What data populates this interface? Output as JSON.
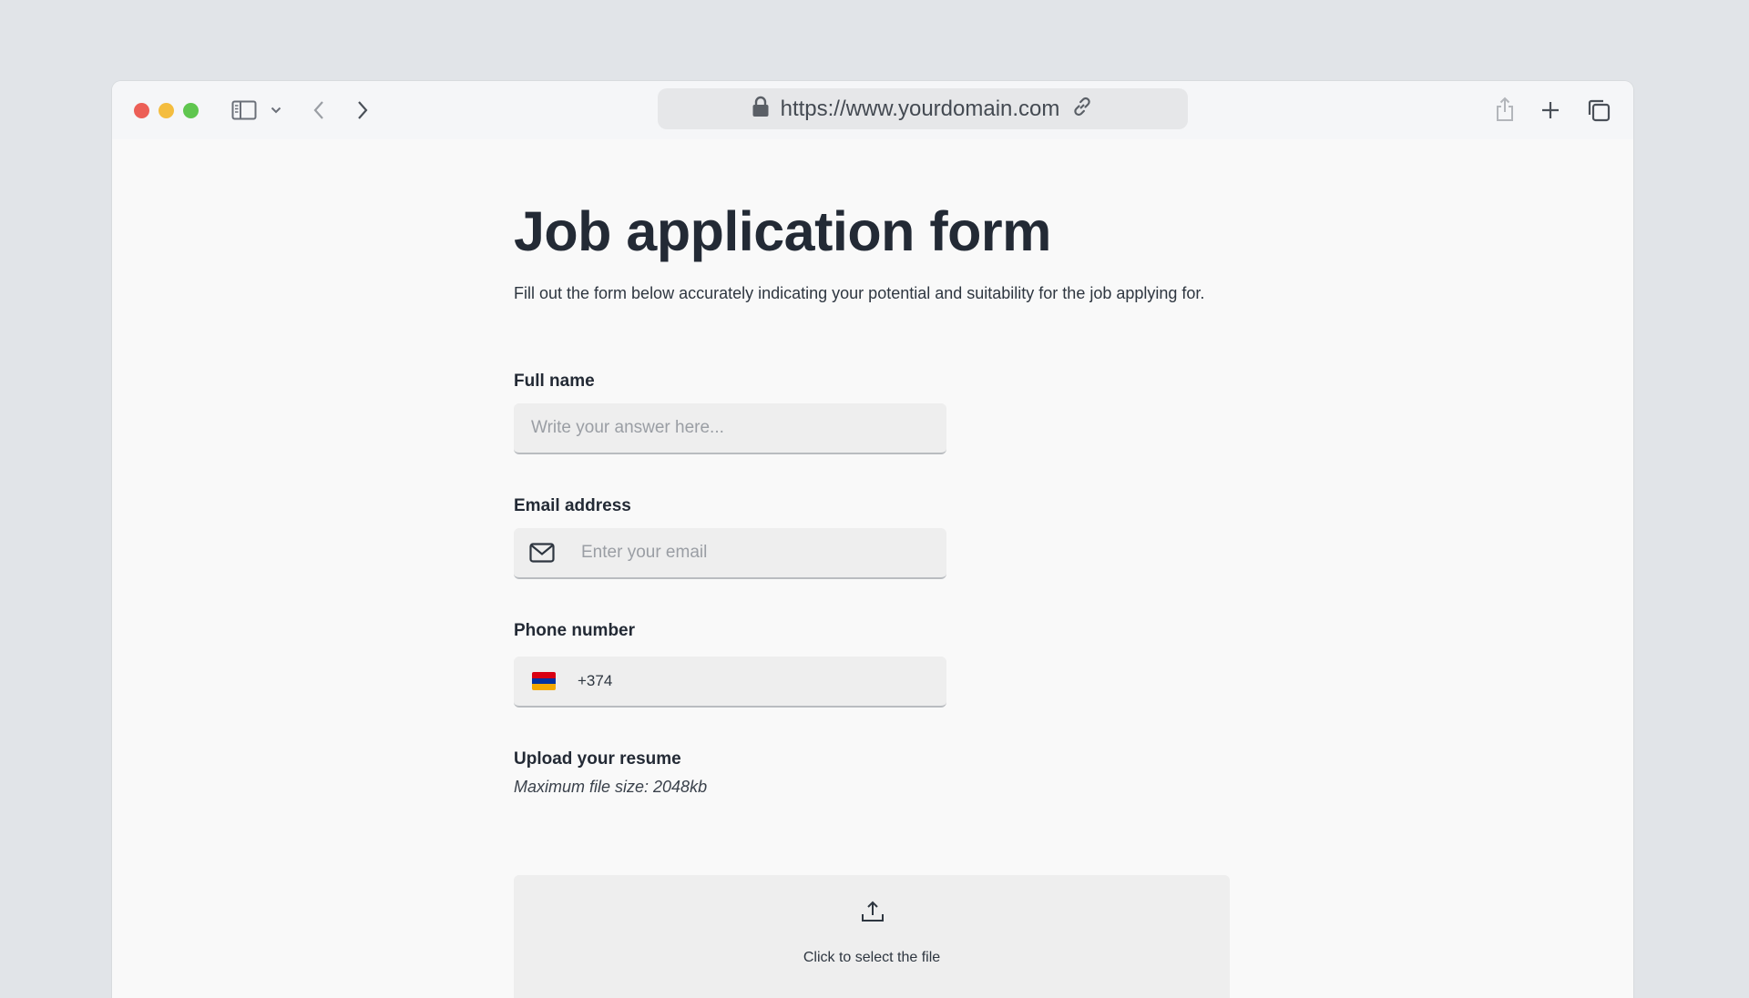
{
  "browser": {
    "url": "https://www.yourdomain.com",
    "icons": [
      "sidebar-icon",
      "chevron-down-icon",
      "back-icon",
      "forward-icon",
      "lock-icon",
      "link-icon",
      "share-icon",
      "plus-icon",
      "tabs-icon"
    ]
  },
  "form": {
    "title": "Job application form",
    "description": "Fill out the form below accurately indicating your potential and suitability for the job applying for.",
    "full_name": {
      "label": "Full name",
      "placeholder": "Write your answer here..."
    },
    "email": {
      "label": "Email address",
      "placeholder": "Enter your email",
      "icon": "mail-icon"
    },
    "phone": {
      "label": "Phone number",
      "value": "+374",
      "flag": "armenia-flag-icon",
      "flag_colors": [
        "#d90012",
        "#0033a0",
        "#f2a800"
      ]
    },
    "resume": {
      "label": "Upload your resume",
      "hint": "Maximum file size: 2048kb",
      "prompt": "Click to select the file",
      "icon": "upload-icon"
    }
  },
  "colors": {
    "background": "#e1e4e8",
    "page": "#f9f9f9",
    "field": "#eeeeee",
    "text": "#232a35"
  }
}
